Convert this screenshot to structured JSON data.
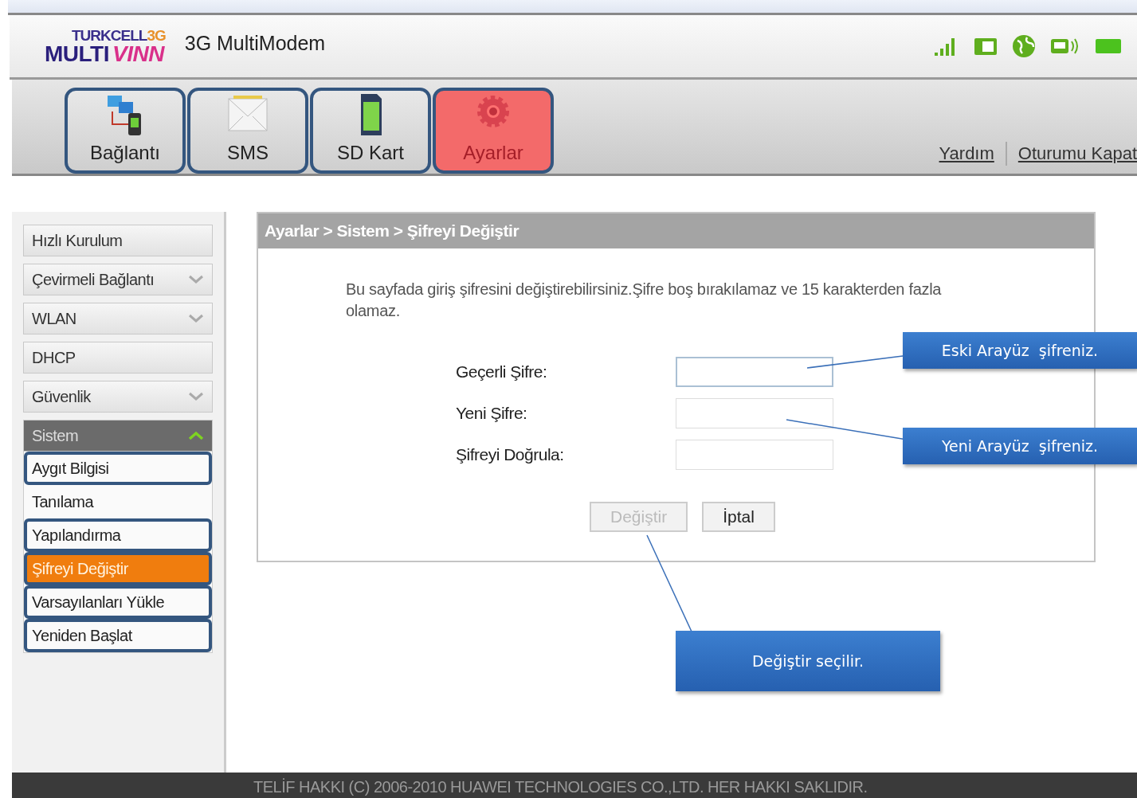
{
  "logo": {
    "brand": "TURKCELL",
    "brand_suffix": "3G",
    "product": "MULTI",
    "product_suffix": "VINN"
  },
  "app_title": "3G MultiModem",
  "tabs": [
    {
      "label": "Bağlantı",
      "kind": "network",
      "selected": false,
      "highlighted": true
    },
    {
      "label": "SMS",
      "kind": "envelope",
      "selected": false,
      "highlighted": true
    },
    {
      "label": "SD Kart",
      "kind": "sdcard",
      "selected": false,
      "highlighted": true
    },
    {
      "label": "Ayarlar",
      "kind": "gear",
      "selected": true,
      "highlighted": true
    }
  ],
  "top_links": [
    "Yardım",
    "Oturumu Kapat"
  ],
  "sidebar": [
    {
      "label": "Hızlı Kurulum",
      "kind": "link"
    },
    {
      "label": "Çevirmeli Bağlantı",
      "kind": "group",
      "expanded": false
    },
    {
      "label": "WLAN",
      "kind": "group",
      "expanded": false
    },
    {
      "label": "DHCP",
      "kind": "link"
    },
    {
      "label": "Güvenlik",
      "kind": "group",
      "expanded": false
    },
    {
      "label": "Sistem",
      "kind": "group",
      "expanded": true,
      "children": [
        {
          "label": "Aygıt Bilgisi",
          "selected": false,
          "highlighted": true
        },
        {
          "label": "Tanılama",
          "selected": false,
          "highlighted": false
        },
        {
          "label": "Yapılandırma",
          "selected": false,
          "highlighted": true
        },
        {
          "label": "Şifreyi Değiştir",
          "selected": true,
          "highlighted": true
        },
        {
          "label": "Varsayılanları Yükle",
          "selected": false,
          "highlighted": true
        },
        {
          "label": "Yeniden Başlat",
          "selected": false,
          "highlighted": true
        }
      ]
    }
  ],
  "panel": {
    "breadcrumb": "Ayarlar > Sistem > Şifreyi Değiştir",
    "description": "Bu sayfada giriş şifresini değiştirebilirsiniz.Şifre boş bırakılamaz ve 15 karakterden fazla olamaz.",
    "fields": [
      {
        "label": "Geçerli Şifre:",
        "focused": true
      },
      {
        "label": "Yeni Şifre:",
        "focused": false
      },
      {
        "label": "Şifreyi Doğrula:",
        "focused": false
      }
    ],
    "buttons": [
      {
        "label": "Değiştir",
        "disabled": true
      },
      {
        "label": "İptal",
        "disabled": false
      }
    ]
  },
  "callouts": [
    "Eski Arayüz  şifreniz.",
    "Yeni Arayüz  şifreniz.",
    "Değiştir seçilir."
  ],
  "footer": "TELİF HAKKI (C) 2006-2010 HUAWEI TECHNOLOGIES CO.,LTD. HER HAKKI SAKLIDIR."
}
